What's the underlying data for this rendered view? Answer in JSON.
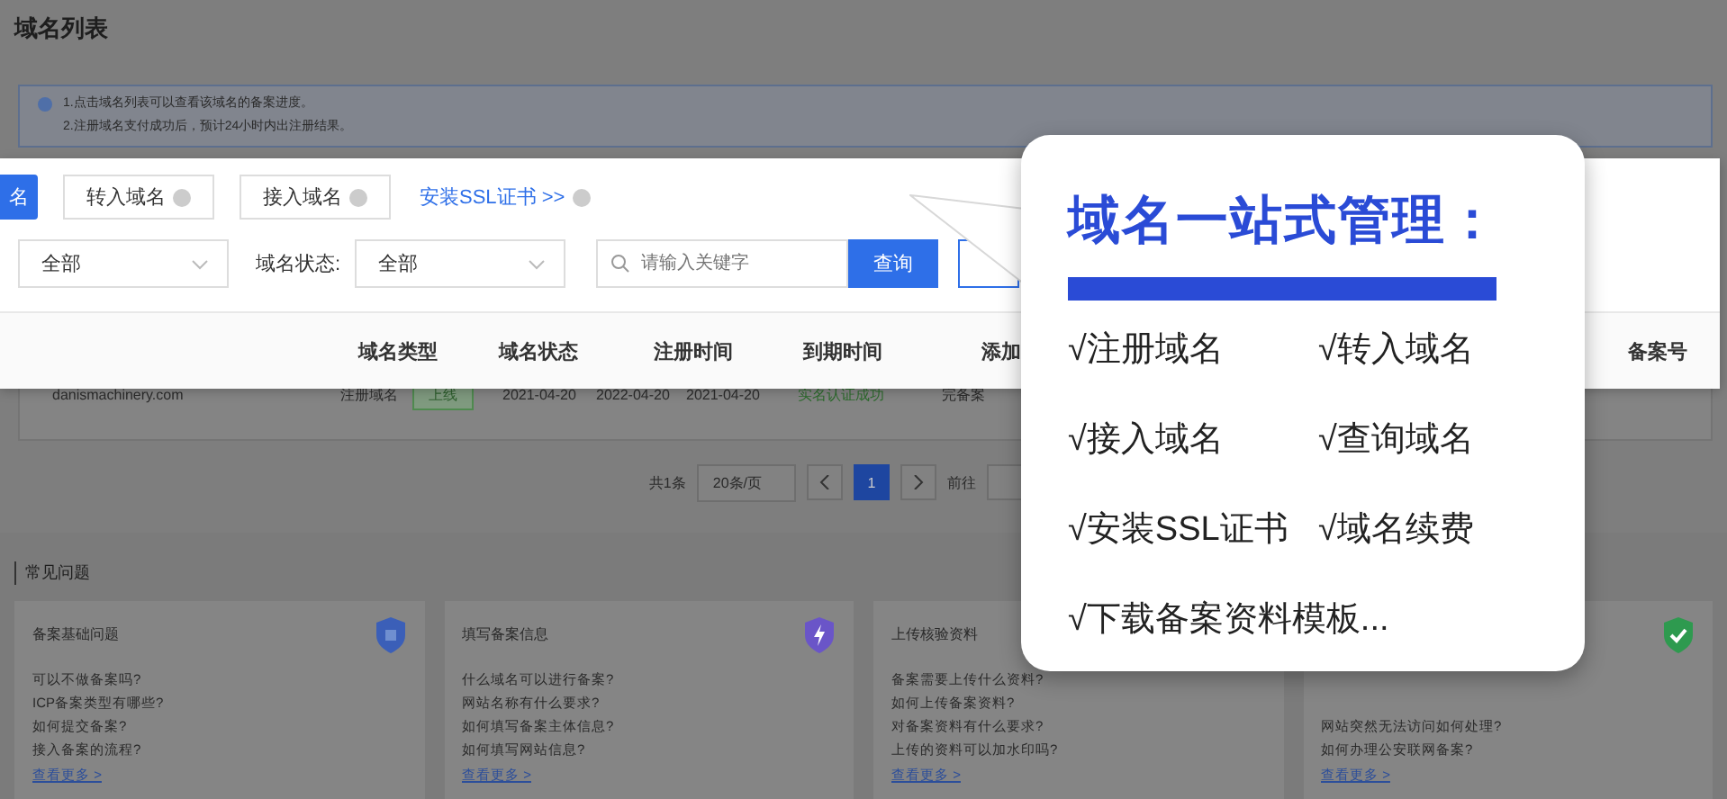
{
  "page_title": "域名列表",
  "notice": {
    "lines": [
      "1.点击域名列表可以查看该域名的备案进度。",
      "2.注册域名支付成功后，预计24小时内出注册结果。"
    ]
  },
  "toolbar": {
    "buttons": [
      {
        "label": "名",
        "kind": "primary"
      },
      {
        "label": "转入域名",
        "kind": "default"
      },
      {
        "label": "接入域名",
        "kind": "default"
      },
      {
        "label": "安装SSL证书 >>",
        "kind": "link"
      },
      {
        "kind": "outline"
      }
    ]
  },
  "filters": [
    {
      "value": "全部"
    },
    {
      "label": "域名状态:",
      "value": "全部"
    }
  ],
  "search": {
    "placeholder": "请输入关键字",
    "button": "查询"
  },
  "header_bar": {
    "columns": [
      "域名类型",
      "域名状态",
      "注册时间",
      "到期时间",
      "添加",
      "备案号"
    ]
  },
  "table": {
    "rows": [
      {
        "cells": [
          "danismachinery.com",
          "注册域名",
          "上线",
          "2021-04-20",
          "2022-04-20",
          "2021-04-20",
          "实名认证成功",
          "完备案"
        ]
      }
    ]
  },
  "pagination": {
    "total": "共1条",
    "page_size": "20条/页",
    "pages": [
      {
        "label": "1",
        "selected": true
      }
    ],
    "goto": "前往"
  },
  "faq": {
    "title": "常见问题",
    "cards": [
      {
        "title": "备案基础问题",
        "items": [
          "可以不做备案吗?",
          "ICP备案类型有哪些?",
          "如何提交备案?",
          "接入备案的流程?"
        ],
        "more": "查看更多 >"
      },
      {
        "title": "填写备案信息",
        "items": [
          "什么域名可以进行备案?",
          "网站名称有什么要求?",
          "如何填写备案主体信息?",
          "如何填写网站信息?"
        ],
        "more": "查看更多 >"
      },
      {
        "title": "上传核验资料",
        "items": [
          "备案需要上传什么资料?",
          "如何上传备案资料?",
          "对备案资料有什么要求?",
          "上传的资料可以加水印吗?"
        ],
        "more": "查看更多 >"
      },
      {
        "items": [
          "网站突然无法访问如何处理?",
          "如何办理公安联网备案?"
        ],
        "more": "查看更多 >"
      }
    ]
  },
  "popup": {
    "title": "域名一站式管理：",
    "items": [
      "√注册域名",
      "√转入域名",
      "√接入域名",
      "√查询域名",
      "√安装SSL证书",
      "√域名续费",
      "√下载备案资料模板..."
    ]
  }
}
